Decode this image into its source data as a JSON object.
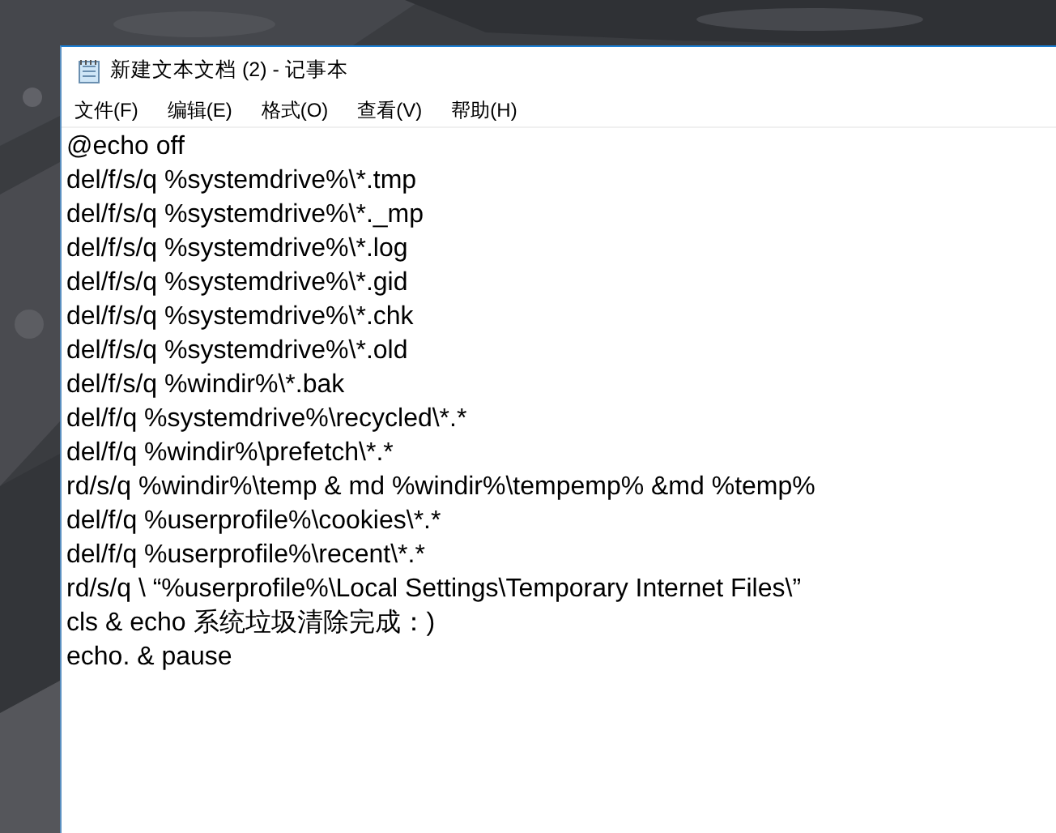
{
  "window": {
    "title": "新建文本文档 (2) - 记事本"
  },
  "menu": [
    "文件(F)",
    "编辑(E)",
    "格式(O)",
    "查看(V)",
    "帮助(H)"
  ],
  "editor": {
    "lines": [
      "@echo off",
      "del/f/s/q %systemdrive%\\*.tmp",
      "del/f/s/q %systemdrive%\\*._mp",
      "del/f/s/q %systemdrive%\\*.log",
      "del/f/s/q %systemdrive%\\*.gid",
      "del/f/s/q %systemdrive%\\*.chk",
      "del/f/s/q %systemdrive%\\*.old",
      "del/f/s/q %windir%\\*.bak",
      "del/f/q %systemdrive%\\recycled\\*.*",
      "del/f/q %windir%\\prefetch\\*.*",
      "rd/s/q %windir%\\temp & md %windir%\\tempemp% &md %temp%",
      "del/f/q %userprofile%\\cookies\\*.*",
      "del/f/q %userprofile%\\recent\\*.*",
      "rd/s/q \\ “%userprofile%\\Local Settings\\Temporary Internet Files\\”",
      "cls & echo 系统垃圾清除完成：)",
      "echo. & pause"
    ]
  }
}
